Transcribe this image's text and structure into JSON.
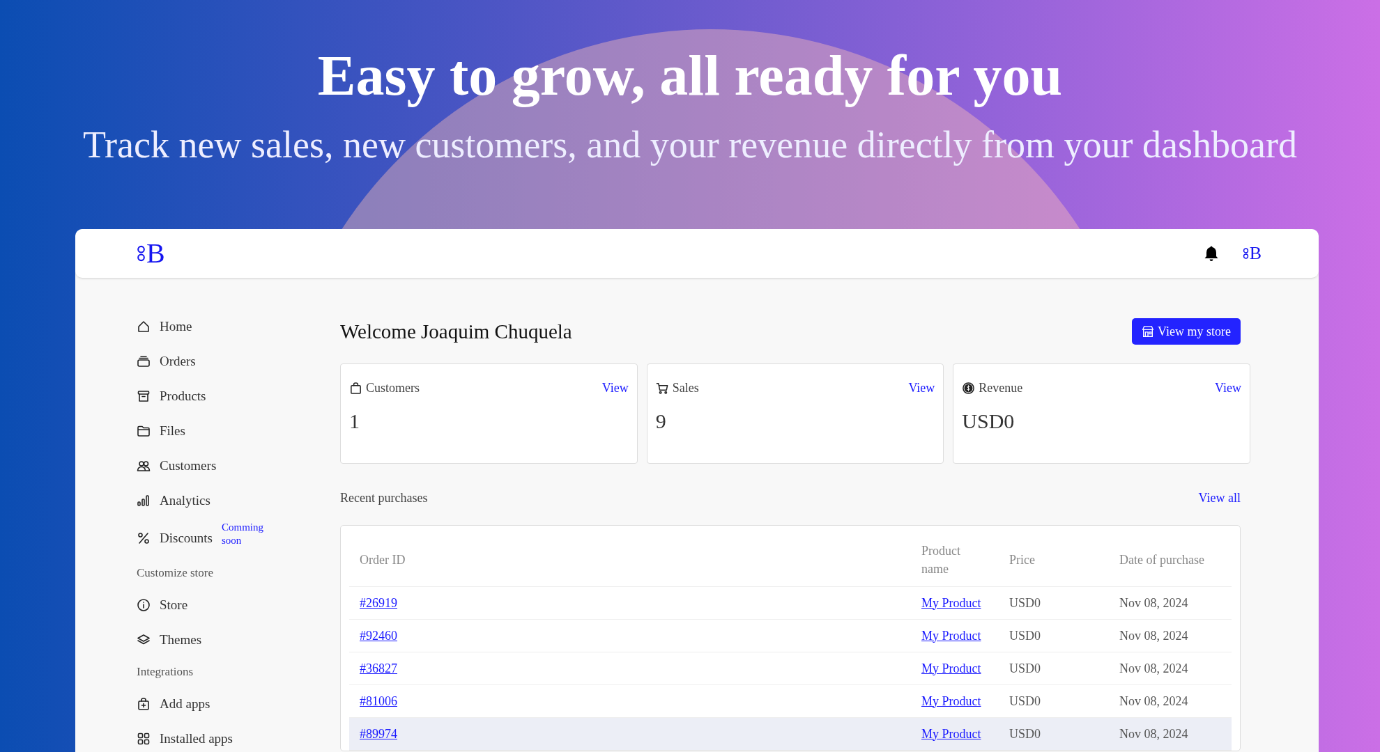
{
  "hero": {
    "title": "Easy to grow, all ready for you",
    "subtitle": "Track new sales, new customers, and your revenue directly from your dashboard"
  },
  "topbar": {
    "logo": "B",
    "avatar": "B"
  },
  "sidebar": {
    "items": [
      {
        "kind": "link",
        "label": "Home"
      },
      {
        "kind": "link",
        "label": "Orders"
      },
      {
        "kind": "link",
        "label": "Products"
      },
      {
        "kind": "link",
        "label": "Files"
      },
      {
        "kind": "link",
        "label": "Customers"
      },
      {
        "kind": "link",
        "label": "Analytics"
      },
      {
        "kind": "link",
        "label": "Discounts",
        "badge": "Comming soon"
      },
      {
        "kind": "heading",
        "label": "Customize store"
      },
      {
        "kind": "link",
        "label": "Store"
      },
      {
        "kind": "link",
        "label": "Themes"
      },
      {
        "kind": "heading",
        "label": "Integrations"
      },
      {
        "kind": "link",
        "label": "Add apps"
      },
      {
        "kind": "link",
        "label": "Installed apps"
      }
    ]
  },
  "main": {
    "welcome": "Welcome Joaquim Chuquela",
    "store_button": "View my store",
    "stats": [
      {
        "label": "Customers",
        "link": "View",
        "value": "1"
      },
      {
        "label": "Sales",
        "link": "View",
        "value": "9"
      },
      {
        "label": "Revenue",
        "link": "View",
        "value": "USD0"
      }
    ],
    "recent": {
      "title": "Recent purchases",
      "link": "View all"
    },
    "table": {
      "columns": [
        "Order ID",
        "Product name",
        "Price",
        "Date of purchase"
      ],
      "rows": [
        {
          "order_id": "#26919",
          "product": "My Product",
          "price": "USD0",
          "date": "Nov 08, 2024",
          "hovered": false
        },
        {
          "order_id": "#92460",
          "product": "My Product",
          "price": "USD0",
          "date": "Nov 08, 2024",
          "hovered": false
        },
        {
          "order_id": "#36827",
          "product": "My Product",
          "price": "USD0",
          "date": "Nov 08, 2024",
          "hovered": false
        },
        {
          "order_id": "#81006",
          "product": "My Product",
          "price": "USD0",
          "date": "Nov 08, 2024",
          "hovered": false
        },
        {
          "order_id": "#89974",
          "product": "My Product",
          "price": "USD0",
          "date": "Nov 08, 2024",
          "hovered": true
        }
      ]
    }
  }
}
